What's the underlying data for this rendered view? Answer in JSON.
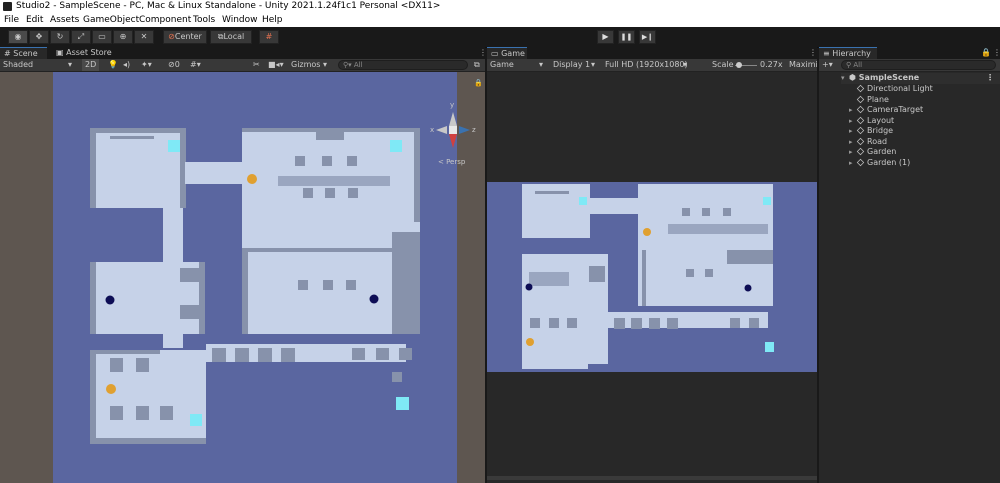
{
  "window": {
    "title": "Studio2 - SampleScene - PC, Mac & Linux Standalone - Unity 2021.1.24f1c1 Personal <DX11>"
  },
  "menu": [
    "File",
    "Edit",
    "Assets",
    "GameObject",
    "Component",
    "Tools",
    "Window",
    "Help"
  ],
  "toolbar": {
    "pivot_label": "Center",
    "space_label": "Local",
    "play_icon": "▶",
    "pause_icon": "❚❚",
    "step_icon": "▶❙"
  },
  "scene_panel": {
    "tabs": [
      {
        "label": "Scene",
        "icon": "hash-icon"
      },
      {
        "label": "Asset Store",
        "icon": "bag-icon"
      }
    ],
    "shading_mode": "Shaded",
    "mode_2d": "2D",
    "gizmos_label": "Gizmos",
    "search_placeholder": "All",
    "persp_label": "< Persp",
    "gizmo_axes": {
      "y": "y",
      "x": "x",
      "z": "z"
    }
  },
  "game_panel": {
    "tab_label": "Game",
    "display_mode": "Game",
    "display": "Display 1",
    "resolution": "Full HD (1920x1080)",
    "scale_label": "Scale",
    "scale_value": "0.27x",
    "maximize_label": "Maximi"
  },
  "hierarchy": {
    "tab_label": "Hierarchy",
    "search_placeholder": "All",
    "scene": "SampleScene",
    "items": [
      {
        "label": "Directional Light",
        "expandable": false
      },
      {
        "label": "Plane",
        "expandable": false
      },
      {
        "label": "CameraTarget",
        "expandable": true
      },
      {
        "label": "Layout",
        "expandable": true
      },
      {
        "label": "Bridge",
        "expandable": true
      },
      {
        "label": "Road",
        "expandable": true
      },
      {
        "label": "Garden",
        "expandable": true
      },
      {
        "label": "Garden (1)",
        "expandable": true
      }
    ]
  },
  "colors": {
    "accent": "#3a72b0",
    "scene_ground": "#5a66a0",
    "floor": "#c6d2e8",
    "wall": "#8792ab",
    "trigger": "#7fe9f6",
    "enemy": "#0d0d55",
    "player": "#e0a030"
  }
}
